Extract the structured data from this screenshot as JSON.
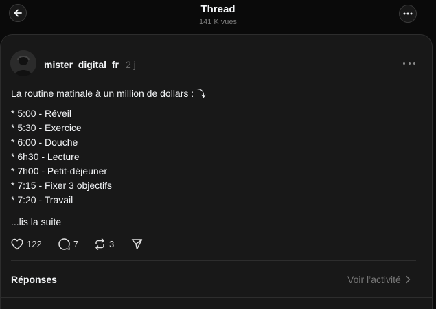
{
  "header": {
    "title": "Thread",
    "views": "141 K vues",
    "back_icon": "arrow-left-icon",
    "menu_icon": "more-horizontal-icon"
  },
  "post": {
    "username": "mister_digital_fr",
    "time_ago": "2 j",
    "intro": "La routine matinale à un million de dollars : ⤵",
    "items": [
      "* 5:00 - Réveil",
      "* 5:30 - Exercice",
      "* 6:00 - Douche",
      "* 6h30 - Lecture",
      "* 7h00 - Petit-déjeuner",
      "* 7:15 - Fixer 3 objectifs",
      "* 7:20 - Travail"
    ],
    "read_more": "...lis la suite",
    "actions": {
      "likes": "122",
      "comments": "7",
      "reposts": "3"
    }
  },
  "replies": {
    "label": "Réponses",
    "activity_link": "Voir l’activité"
  },
  "colors": {
    "background": "#0a0a0a",
    "card": "#181818",
    "text": "#f3f5f7",
    "muted": "#777777"
  }
}
